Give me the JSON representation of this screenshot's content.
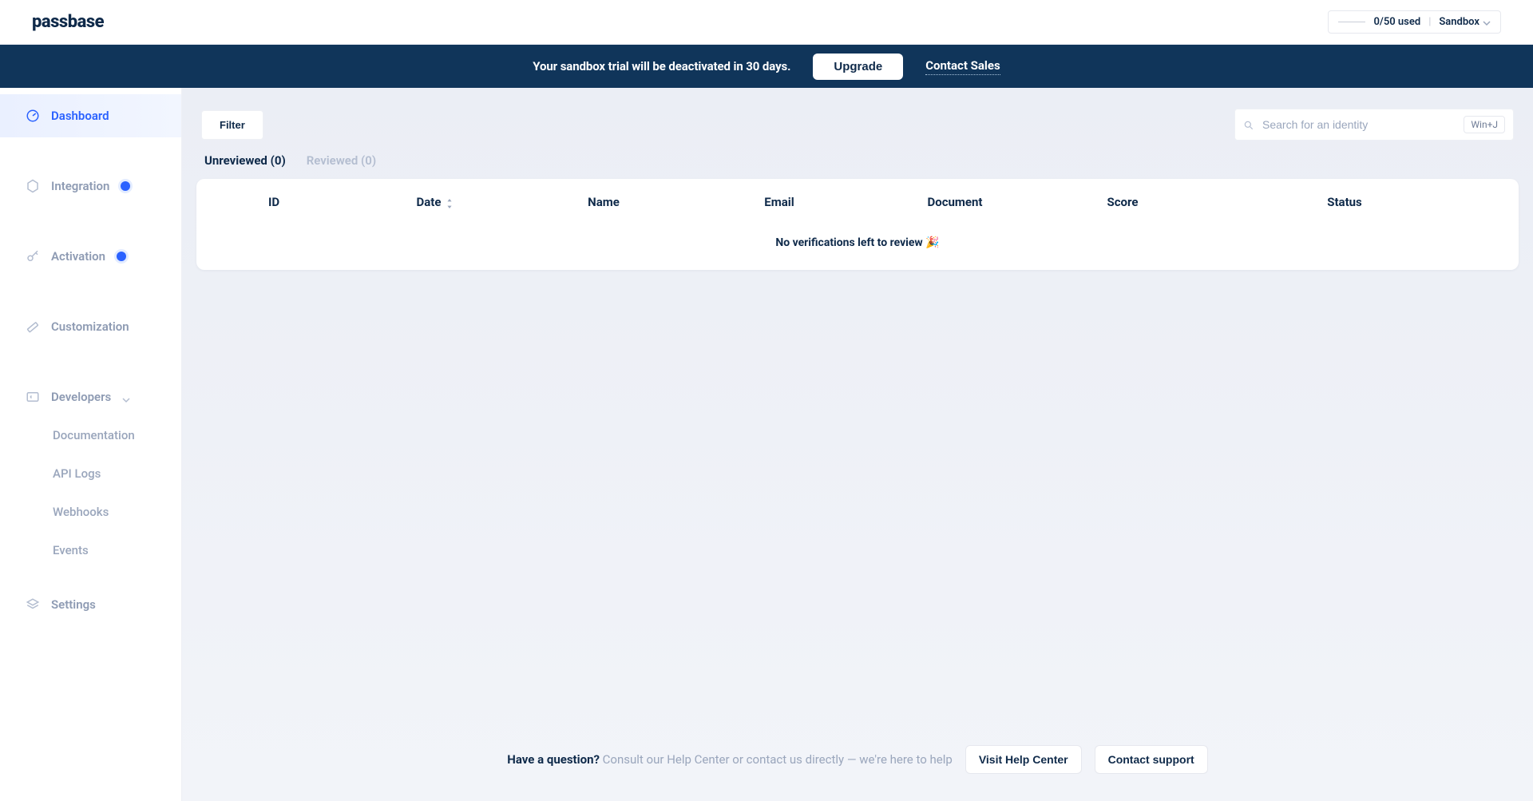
{
  "header": {
    "logo": "passbase",
    "usage": "0/50 used",
    "env": "Sandbox"
  },
  "banner": {
    "text": "Your sandbox trial will be deactivated in 30 days.",
    "upgrade": "Upgrade",
    "contact": "Contact Sales"
  },
  "sidebar": {
    "dashboard": "Dashboard",
    "integration": "Integration",
    "activation": "Activation",
    "customization": "Customization",
    "developers": "Developers",
    "documentation": "Documentation",
    "apilogs": "API Logs",
    "webhooks": "Webhooks",
    "events": "Events",
    "settings": "Settings"
  },
  "toolbar": {
    "filter": "Filter",
    "search_placeholder": "Search for an identity",
    "kbd": "Win+J"
  },
  "tabs": {
    "unreviewed": "Unreviewed (0)",
    "reviewed": "Reviewed (0)"
  },
  "table": {
    "columns": {
      "id": "ID",
      "date": "Date",
      "name": "Name",
      "email": "Email",
      "document": "Document",
      "score": "Score",
      "status": "Status"
    },
    "empty": "No verifications left to review 🎉"
  },
  "footer": {
    "question": "Have a question?",
    "subtext": " Consult our Help Center or contact us directly — we're here to help",
    "help": "Visit Help Center",
    "support": "Contact support"
  }
}
